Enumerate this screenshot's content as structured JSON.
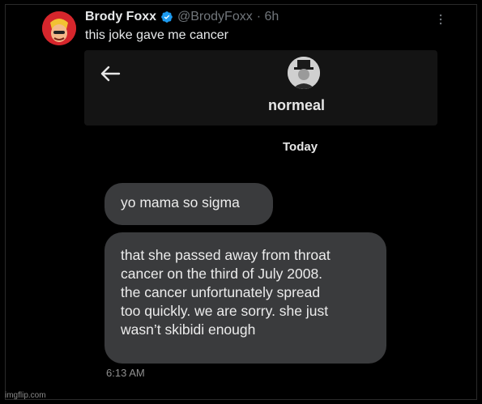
{
  "tweet": {
    "display_name": "Brody Foxx",
    "handle": "@BrodyFoxx",
    "time": "· 6h",
    "text": "this joke gave me cancer"
  },
  "chat": {
    "contact_name": "normeal",
    "date_label": "Today",
    "messages": [
      {
        "lines": [
          "yo mama so sigma"
        ]
      },
      {
        "lines": [
          "that she passed away from throat",
          "cancer on the third of July 2008.",
          "the cancer unfortunately spread",
          "too quickly. we are sorry. she just",
          "wasn’t skibidi enough"
        ]
      }
    ],
    "timestamp": "6:13 AM"
  },
  "watermark": "imgflip.com",
  "colors": {
    "background": "#000000",
    "bubble": "#3a3b3d",
    "verified": "#1d9bf0",
    "avatar_bg": "#d6262c"
  },
  "icons": {
    "verified": "verified-badge-icon",
    "more": "more-options-icon",
    "back": "back-arrow-icon"
  }
}
